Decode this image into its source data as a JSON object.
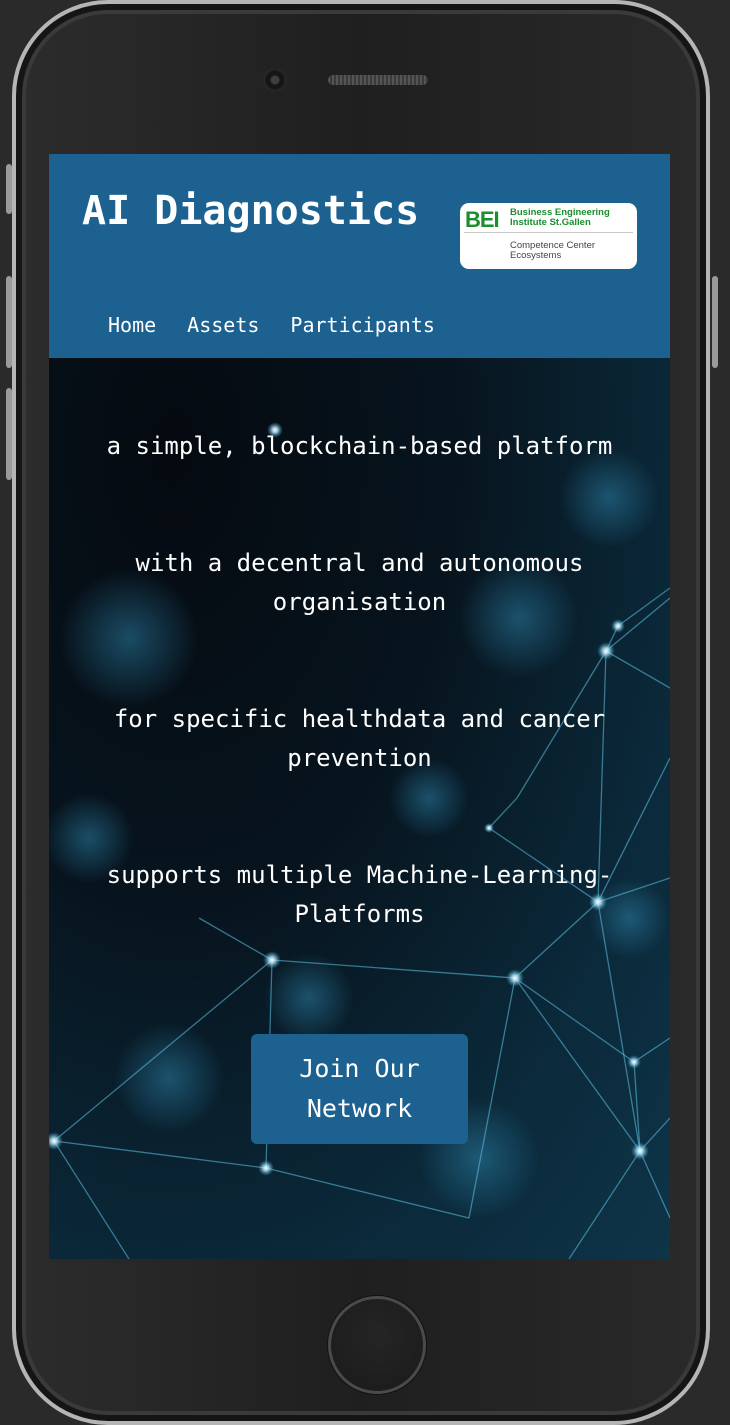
{
  "header": {
    "title": "AI Diagnostics",
    "logo": {
      "mark": "BEI",
      "name_line1": "Business Engineering",
      "name_line2": "Institute St.Gallen",
      "sub_line1": "Competence Center",
      "sub_line2": "Ecosystems"
    },
    "nav": [
      "Home",
      "Assets",
      "Participants"
    ]
  },
  "hero": {
    "lines": [
      "a simple, blockchain-based platform",
      "with a decentral and autonomous organisation",
      "for specific healthdata and cancer prevention",
      "supports multiple Machine-Learning-Platforms"
    ],
    "cta_label": "Join Our Network"
  },
  "colors": {
    "header_bg": "#1c6190",
    "button_bg": "#1c6190",
    "logo_green": "#1a8f2e",
    "text": "#ffffff"
  }
}
